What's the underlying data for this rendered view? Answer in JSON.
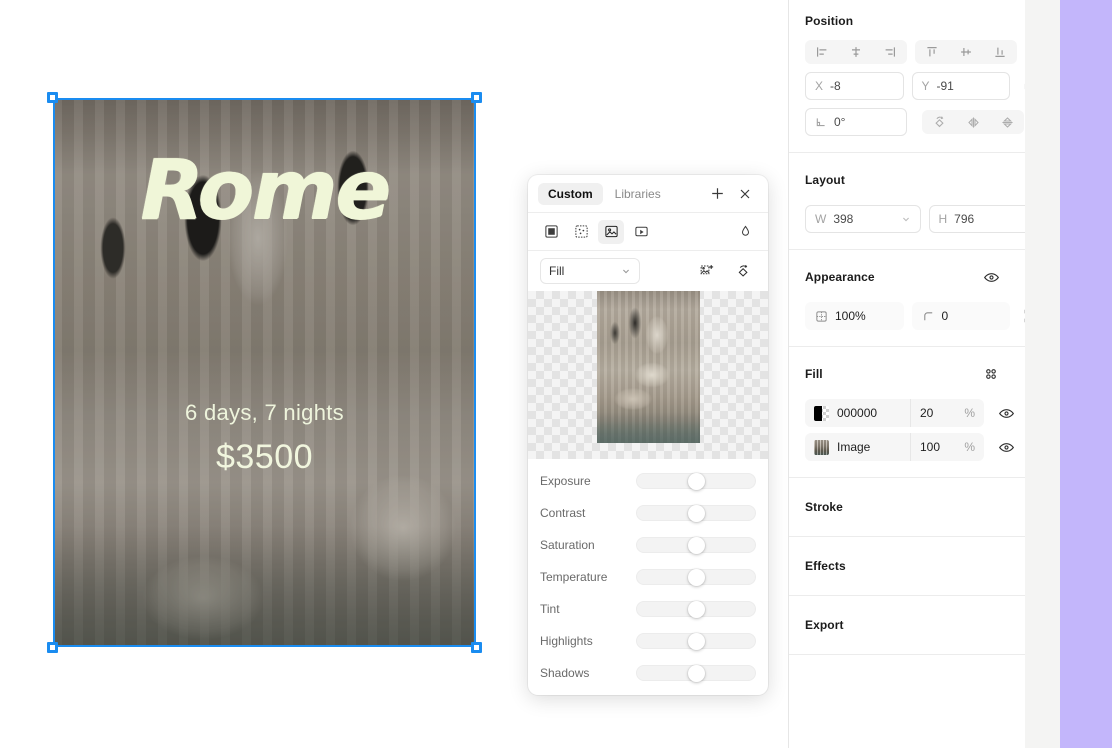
{
  "canvas": {
    "artboard": {
      "headline": "Rome",
      "subline": "6 days, 7 nights",
      "price": "$3500",
      "text_color": "#f0f6d8",
      "selection_color": "#1a8cf0"
    }
  },
  "image_panel": {
    "tabs": [
      {
        "label": "Custom",
        "active": true
      },
      {
        "label": "Libraries",
        "active": false
      }
    ],
    "add_label": "+",
    "close_label": "✕",
    "tools": [
      {
        "name": "adjust-icon",
        "selected": false
      },
      {
        "name": "noise-icon",
        "selected": false
      },
      {
        "name": "image-icon",
        "selected": true
      },
      {
        "name": "video-icon",
        "selected": false
      }
    ],
    "blend_icon": "droplet-icon",
    "mode": {
      "value": "Fill",
      "caret": "⌄"
    },
    "actions": [
      {
        "name": "image-ai-icon"
      },
      {
        "name": "reset-rotate-icon"
      }
    ],
    "sliders": [
      {
        "label": "Exposure",
        "value": 0
      },
      {
        "label": "Contrast",
        "value": 0
      },
      {
        "label": "Saturation",
        "value": 0
      },
      {
        "label": "Temperature",
        "value": 0
      },
      {
        "label": "Tint",
        "value": 0
      },
      {
        "label": "Highlights",
        "value": 0
      },
      {
        "label": "Shadows",
        "value": 0
      }
    ]
  },
  "properties": {
    "position": {
      "title": "Position",
      "align_h": [
        "align-left-icon",
        "align-center-horizontal-icon",
        "align-right-icon"
      ],
      "align_v": [
        "align-top-icon",
        "align-center-vertical-icon",
        "align-bottom-icon"
      ],
      "x": {
        "label": "X",
        "value": "-8"
      },
      "y": {
        "label": "Y",
        "value": "-91"
      },
      "add_icon": "add-constraint-icon",
      "rotation": {
        "label": "angle-icon",
        "value": "0°"
      },
      "transform_icons": [
        "rotate-icon",
        "flip-horizontal-icon",
        "flip-vertical-icon"
      ]
    },
    "layout": {
      "title": "Layout",
      "collapse_icon": "resize-to-fit-icon",
      "w": {
        "label": "W",
        "value": "398"
      },
      "h": {
        "label": "H",
        "value": "796"
      }
    },
    "appearance": {
      "title": "Appearance",
      "visibility_icon": "eye-icon",
      "blend_icon": "droplet-icon",
      "opacity": {
        "value": "100%",
        "icon": "opacity-icon"
      },
      "corner_radius": {
        "value": "0",
        "icon": "corner-radius-icon"
      },
      "independent_corners_icon": "independent-corners-icon"
    },
    "fill": {
      "title": "Fill",
      "styles_icon": "styles-icon",
      "add_icon": "plus-icon",
      "items": [
        {
          "name": "000000",
          "opacity": "20",
          "unit": "%",
          "swatch": "color",
          "selected": true
        },
        {
          "name": "Image",
          "opacity": "100",
          "unit": "%",
          "swatch": "image",
          "selected": false
        }
      ]
    },
    "collapsed_sections": [
      {
        "title": "Stroke",
        "add_icon": "plus-icon"
      },
      {
        "title": "Effects",
        "add_icon": "plus-icon"
      },
      {
        "title": "Export",
        "add_icon": "plus-icon"
      }
    ]
  },
  "accent_strip_color": "#c3b6fb"
}
